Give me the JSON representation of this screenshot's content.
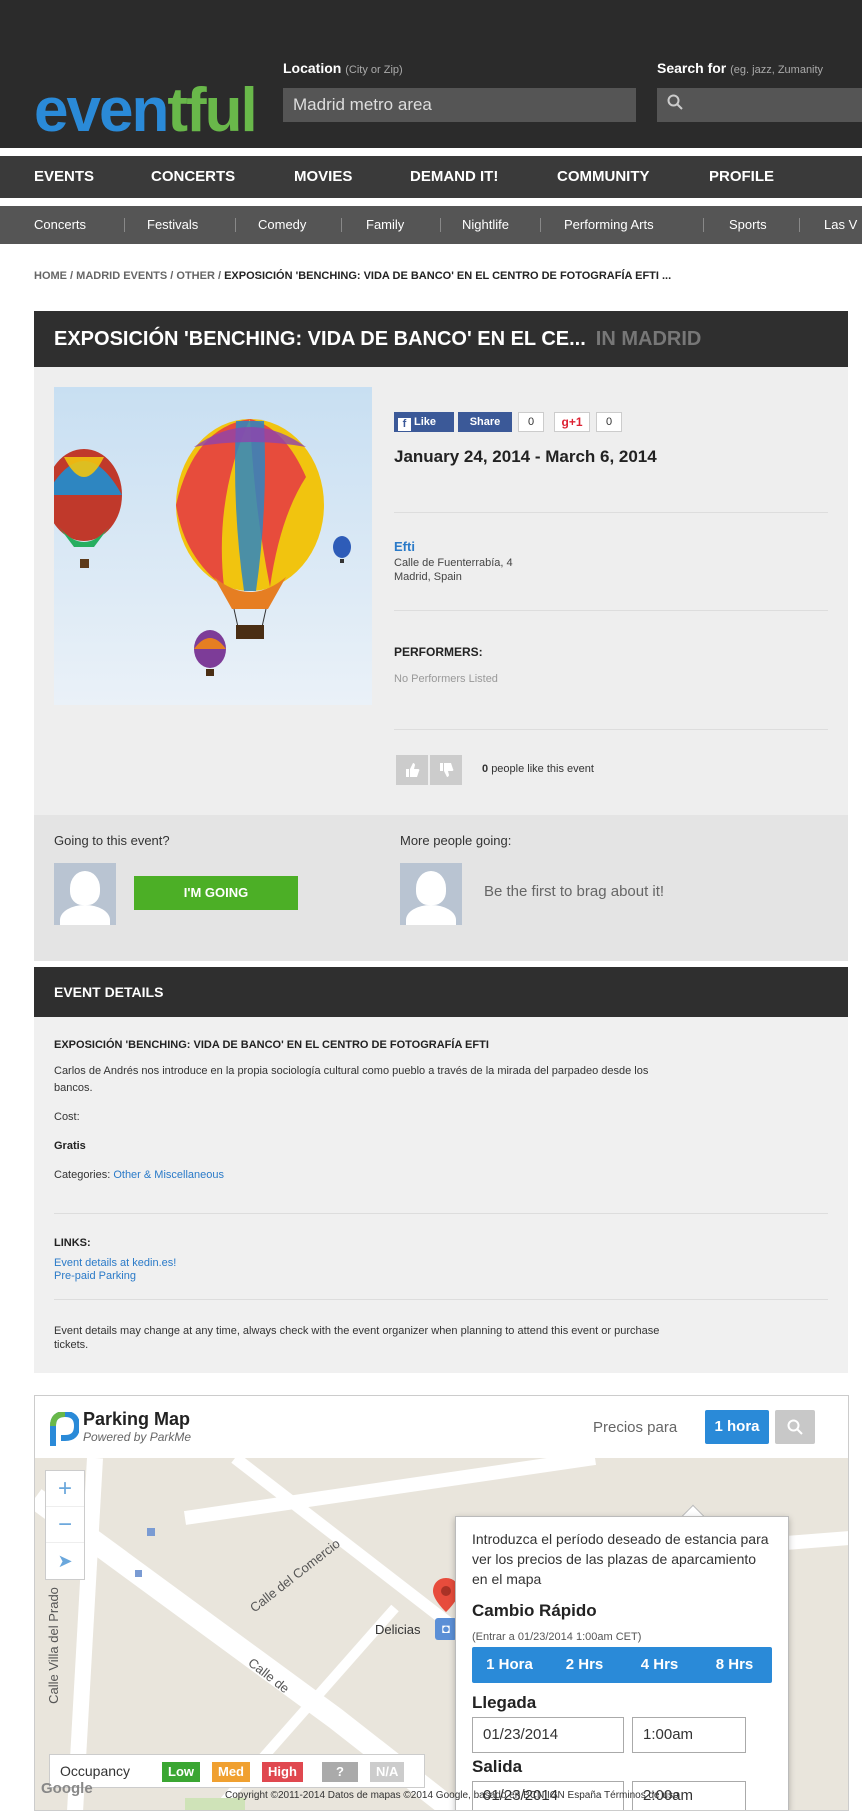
{
  "header": {
    "logo_part1": "even",
    "logo_part2": "tful",
    "location_label": "Location",
    "location_hint": "(City or Zip)",
    "location_value": "Madrid metro area",
    "search_label": "Search for",
    "search_hint": "(eg. jazz, Zumanity",
    "search_value": ""
  },
  "main_nav": [
    "EVENTS",
    "CONCERTS",
    "MOVIES",
    "DEMAND IT!",
    "COMMUNITY",
    "PROFILE"
  ],
  "sub_nav": [
    "Concerts",
    "Festivals",
    "Comedy",
    "Family",
    "Nightlife",
    "Performing Arts",
    "Sports",
    "Las V"
  ],
  "breadcrumb": {
    "trail": "HOME / MADRID EVENTS / OTHER / ",
    "current": "EXPOSICIÓN 'BENCHING: VIDA DE BANCO' EN EL CENTRO DE FOTOGRAFÍA EFTI ..."
  },
  "event": {
    "title": "EXPOSICIÓN 'BENCHING: VIDA DE BANCO' EN EL CE...",
    "city": "IN MADRID",
    "social": {
      "like_label": "Like",
      "share_label": "Share",
      "share_count": "0",
      "gplus_label": "g+1",
      "gplus_count": "0"
    },
    "dates": "January 24, 2014 - March 6, 2014",
    "venue_name": "Efti",
    "venue_address1": "Calle de Fuenterrabía, 4",
    "venue_address2": "Madrid, Spain",
    "performers_label": "PERFORMERS:",
    "performers_value": "No Performers Listed",
    "likes_count": "0",
    "likes_text": "people like this event"
  },
  "going": {
    "question": "Going to this event?",
    "button": "I'M GOING",
    "more_label": "More people going:",
    "brag": "Be the first to brag about it!"
  },
  "details": {
    "header": "EVENT DETAILS",
    "title": "EXPOSICIÓN 'BENCHING: VIDA DE BANCO' EN EL CENTRO DE FOTOGRAFÍA EFTI",
    "description_line1": "Carlos de Andrés nos introduce en la propia sociología cultural como pueblo a través de la mirada del parpadeo desde los",
    "description_line2": "bancos.",
    "cost_label": "Cost:",
    "cost_value": "Gratis",
    "categories_label": "Categories:",
    "categories_value": "Other & Miscellaneous",
    "links_label": "LINKS:",
    "link1": "Event details at kedin.es!",
    "link2": "Pre-paid Parking",
    "disclaimer_line1": "Event details may change at any time, always check with the event organizer when planning to attend this event or purchase",
    "disclaimer_line2": "tickets."
  },
  "parking": {
    "title": "Parking Map",
    "subtitle": "Powered by ParkMe",
    "precios_label": "Precios para",
    "hora_button": "1 hora",
    "popup": {
      "intro": "Introduzca el período deseado de estancia para ver los precios de las plazas de aparcamiento en el mapa",
      "cambio": "Cambio Rápido",
      "entrar": "(Entrar a 01/23/2014 1:00am CET)",
      "buttons": [
        "1 Hora",
        "2 Hrs",
        "4 Hrs",
        "8 Hrs"
      ],
      "llegada_label": "Llegada",
      "llegada_date": "01/23/2014",
      "llegada_time": "1:00am",
      "salida_label": "Salida",
      "salida_date": "01/23/2014",
      "salida_time": "2:00am"
    },
    "map": {
      "street1": "Calle del Comercio",
      "street2": "Calle Villa del Prado",
      "street3": "Calle de",
      "station": "Delicias",
      "google": "Google",
      "copyright": "Copyright ©2011-2014  Datos de mapas ©2014 Google, basado en BCN IGN España    Términos de uso"
    },
    "occupancy": {
      "label": "Occupancy",
      "chips": [
        "Low",
        "Med",
        "High",
        "?",
        "N/A"
      ]
    }
  }
}
